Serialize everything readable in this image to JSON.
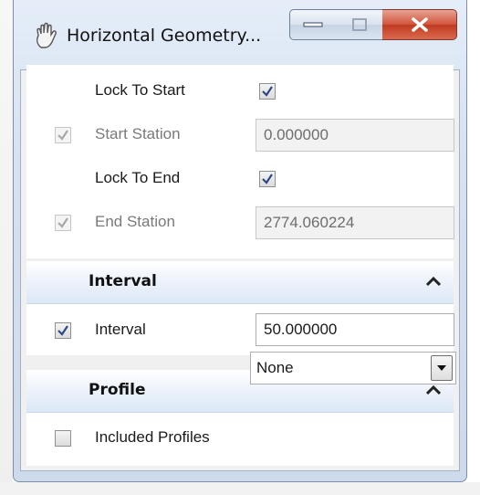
{
  "window": {
    "title": "Horizontal Geometry...",
    "minimize_icon": "minimize-icon",
    "maximize_icon": "maximize-icon",
    "close_icon": "close-icon",
    "app_icon": "hand-icon"
  },
  "station": {
    "lock_to_start": {
      "label": "Lock To Start",
      "checked": true
    },
    "start_station": {
      "label": "Start Station",
      "value": "0.000000",
      "checked": true,
      "enabled": false
    },
    "lock_to_end": {
      "label": "Lock To End",
      "checked": true
    },
    "end_station": {
      "label": "End Station",
      "value": "2774.060224",
      "checked": true,
      "enabled": false
    }
  },
  "interval_section": {
    "title": "Interval",
    "collapse_icon": "chevron-up-icon",
    "interval": {
      "label": "Interval",
      "value": "50.000000",
      "checked": true
    }
  },
  "profile_section": {
    "title": "Profile",
    "collapse_icon": "chevron-up-icon",
    "included_profiles": {
      "label": "Included Profiles",
      "value": "None",
      "checked": false,
      "dropdown_icon": "chevron-down-icon"
    }
  },
  "colors": {
    "titlebar": "#d6e2f1",
    "close_button": "#c94f37",
    "section_header": "#dce8f7",
    "checkmark": "#2b4a85"
  }
}
